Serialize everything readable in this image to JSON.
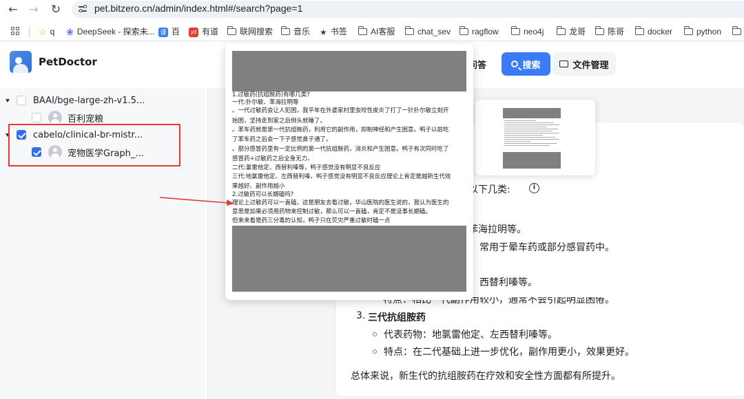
{
  "browser": {
    "url": "pet.bitzero.cn/admin/index.html#/search?page=1",
    "bookmarks": [
      {
        "label": "q",
        "icon": "star-icon"
      },
      {
        "label": "DeepSeek - 探索未...",
        "icon": "deepseek-icon"
      },
      {
        "label": "百",
        "icon": "translate-icon"
      },
      {
        "label": "有道",
        "icon": "youdao-icon"
      },
      {
        "label": "联网搜索",
        "icon": "folder-icon"
      },
      {
        "label": "音乐",
        "icon": "folder-icon"
      },
      {
        "label": "书签",
        "icon": "star-filled-icon"
      },
      {
        "label": "AI客服",
        "icon": "folder-icon"
      },
      {
        "label": "chat_sev",
        "icon": "folder-icon"
      },
      {
        "label": "ragflow",
        "icon": "folder-icon"
      },
      {
        "label": "neo4j",
        "icon": "folder-icon"
      },
      {
        "label": "龙哥",
        "icon": "folder-icon"
      },
      {
        "label": "陈哥",
        "icon": "folder-icon"
      },
      {
        "label": "docker",
        "icon": "folder-icon"
      },
      {
        "label": "python",
        "icon": "folder-icon"
      }
    ]
  },
  "app": {
    "name": "PetDoctor"
  },
  "tree": {
    "groups": [
      {
        "label": "BAAI/bge-large-zh-v1.5...",
        "checked": false,
        "child": {
          "label": "百利宠粮",
          "checked": false
        }
      },
      {
        "label": "cabelo/clinical-br-mistr...",
        "checked": true,
        "child": {
          "label": "宠物医学Graph_...",
          "checked": true
        }
      }
    ]
  },
  "toolbar": {
    "qa_label": "问答",
    "search_label": "搜索",
    "files_label": "文件管理"
  },
  "preview": {
    "lines": [
      "1.过敏药(抗组胺药)有哪几类?",
      "一代:扑尔敏、苯海拉明等",
      "。一代过敏药会让人犯困，我平年在外婆家村里虫咬性皮炎了打了一针扑尔敏立刻开",
      "始困，坚持走到家之后倒头就睡了。",
      "。苯车药就是第一代抗组胺药，利用它的副作用，抑制神经和产生困意。鸭子以前吃",
      "了苯车药之后会一下子感觉鼻子通了。",
      "。部分感冒药里有一定比例的第一代抗组胺药，消炎和产生困意。鸭子有次同时吃了",
      "感冒药+过敏药之后全身无力。",
      "二代:氯雷他定、西替利嗪等，鸭子感觉没有明显不良反应",
      "三代:地氯雷他定、左西替利嗪，鸭子感觉没有明显不良反应理论上肯定是越新生代效",
      "果越好、副作用越小",
      "2.过敏药可以长期磕吗?",
      "理论上过敏药可以一直磕，这是朋友去看过敏，华山医院的医生说的，我认为医生的",
      "意思是如果必须用药物来控制过敏，那么可以一直磕，肯定不是没事长期磕。",
      "但来来看是药三分毒的认知，鸭子只在荧灾严重过敏时磕一点"
    ]
  },
  "answer": {
    "intro_fragment": "以下几类:",
    "gen1_fragment": "苯海拉明等。",
    "gen1_feature_fragment": "常用于晕车药或部分感冒药中。",
    "gen2_fragment": "西替利嗪等。",
    "gen2_feature_fragment": "特点：相比一代副作用较小，通常不会引起明显困倦。",
    "gen3_number": "3.",
    "gen3_title": "三代抗组胺药",
    "gen3_drugs": "代表药物：地氯雷他定、左西替利嗪等。",
    "gen3_feature": "特点：在二代基础上进一步优化，副作用更小，效果更好。",
    "summary": "总体来说，新生代的抗组胺药在疗效和安全性方面都有所提升。"
  }
}
